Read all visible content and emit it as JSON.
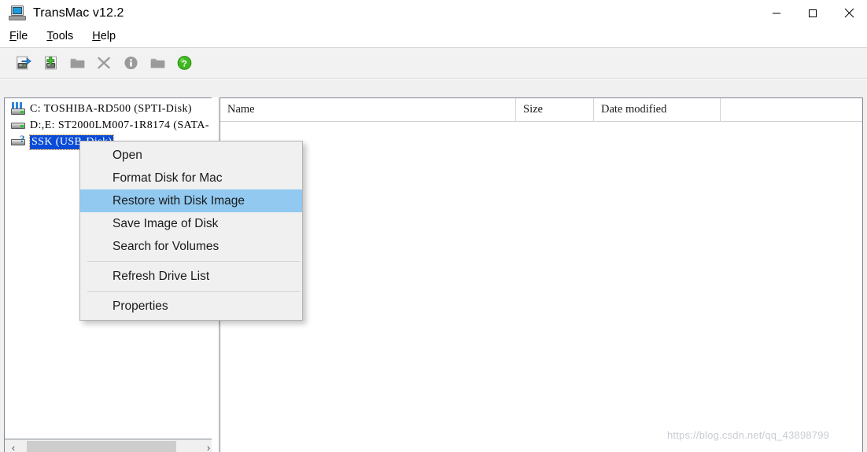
{
  "window": {
    "title": "TransMac v12.2",
    "icon": "computer-monitor-icon",
    "controls": {
      "minimize": "Minimize",
      "maximize": "Maximize",
      "close": "Close"
    }
  },
  "menubar": {
    "items": [
      {
        "label": "File",
        "accel": "F"
      },
      {
        "label": "Tools",
        "accel": "T"
      },
      {
        "label": "Help",
        "accel": "H"
      }
    ]
  },
  "toolbar": {
    "buttons": [
      {
        "name": "open-disk-icon",
        "label": "Open Disk",
        "enabled": true
      },
      {
        "name": "add-disk-image-icon",
        "label": "Add Disk Image",
        "enabled": true
      },
      {
        "name": "new-folder-icon",
        "label": "New Folder",
        "enabled": false
      },
      {
        "name": "delete-icon",
        "label": "Delete",
        "enabled": false
      },
      {
        "name": "info-icon",
        "label": "Properties",
        "enabled": false
      },
      {
        "name": "folder-icon",
        "label": "Folder",
        "enabled": false
      },
      {
        "name": "help-icon",
        "label": "Help",
        "enabled": true
      }
    ]
  },
  "tree": {
    "items": [
      {
        "label": "C:  TOSHIBA-RD500  (SPTI-Disk)",
        "icon": "computer-drive-icon",
        "selected": false
      },
      {
        "label": "D:,E:  ST2000LM007-1R8174  (SATA-",
        "icon": "hard-drive-icon",
        "selected": false
      },
      {
        "label": "SSK  (USB-Disk)",
        "icon": "unknown-drive-icon",
        "selected": true
      }
    ],
    "scrollbar": {
      "left_arrow": "‹",
      "right_arrow": "›"
    }
  },
  "filelist": {
    "columns": [
      {
        "label": "Name"
      },
      {
        "label": "Size"
      },
      {
        "label": "Date modified"
      },
      {
        "label": ""
      }
    ],
    "rows": []
  },
  "contextmenu": {
    "items": [
      {
        "label": "Open",
        "highlight": false,
        "separator_after": false
      },
      {
        "label": "Format Disk for Mac",
        "highlight": false,
        "separator_after": false
      },
      {
        "label": "Restore with Disk Image",
        "highlight": true,
        "separator_after": false
      },
      {
        "label": "Save Image of Disk",
        "highlight": false,
        "separator_after": false
      },
      {
        "label": "Search for Volumes",
        "highlight": false,
        "separator_after": true
      },
      {
        "label": "Refresh Drive List",
        "highlight": false,
        "separator_after": true
      },
      {
        "label": "Properties",
        "highlight": false,
        "separator_after": false
      }
    ]
  },
  "watermark": {
    "text": "https://blog.csdn.net/qq_43898799"
  },
  "colors": {
    "menu_highlight": "#91c9f0",
    "tree_selection": "#0a4bd8",
    "toolbar_bg": "#f2f2f2",
    "client_bg": "#f0f0f0",
    "panel_border": "#828790"
  }
}
